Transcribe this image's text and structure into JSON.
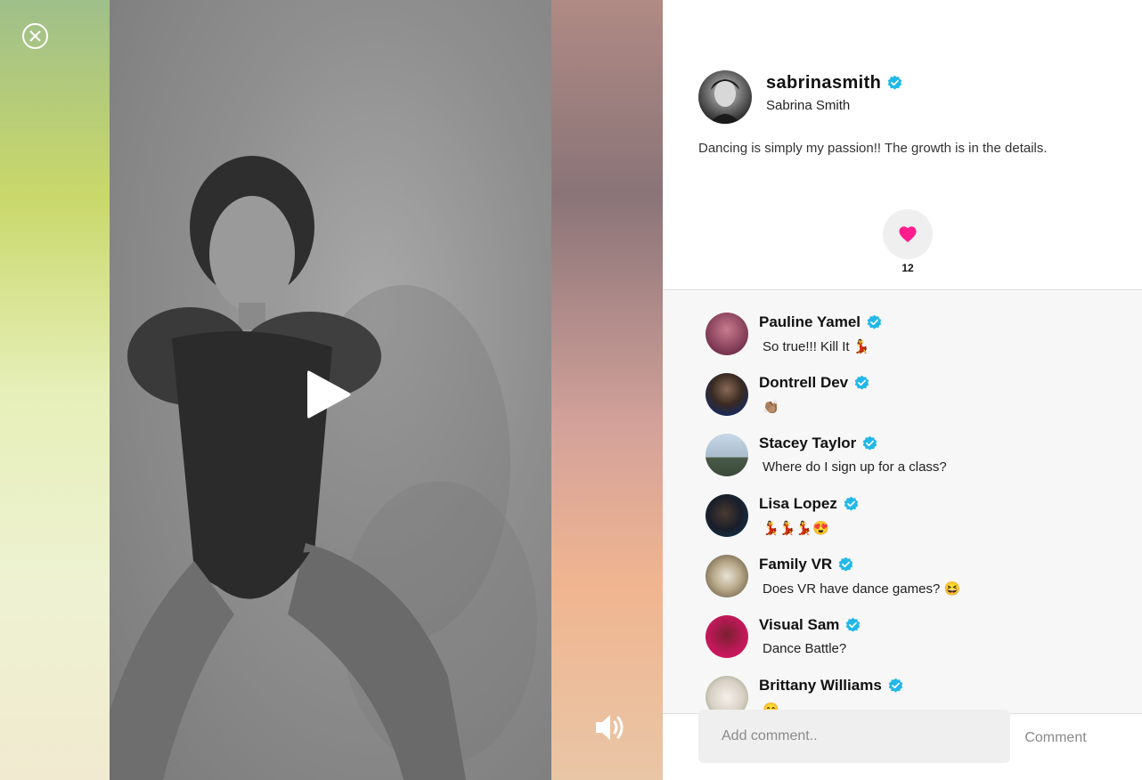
{
  "post": {
    "username": "sabrinasmith",
    "full_name": "Sabrina Smith",
    "caption": "Dancing is simply my passion!! The growth is in the details.",
    "like_count": "12",
    "verified": true
  },
  "media": {
    "close_icon": "close-circle-icon",
    "play_icon": "play-icon",
    "volume_icon": "volume-icon"
  },
  "comments": [
    {
      "name": "Pauline Yamel",
      "text": "So true!!! Kill It 💃",
      "avatar_color": "#8e4f6a"
    },
    {
      "name": "Dontrell Dev",
      "text": "👏🏽",
      "avatar_color": "#3a3a3a"
    },
    {
      "name": "Stacey Taylor",
      "text": "Where do I sign up for a class?",
      "avatar_color": "#9fb6c8"
    },
    {
      "name": "Lisa Lopez",
      "text": "💃💃💃😍",
      "avatar_color": "#1a2a3a"
    },
    {
      "name": "Family VR",
      "text": "Does VR have dance games? 😆",
      "avatar_color": "#b8a98a"
    },
    {
      "name": "Visual Sam",
      "text": "Dance Battle?",
      "avatar_color": "#c2185b"
    },
    {
      "name": "Brittany Williams",
      "text": "😊",
      "avatar_color": "#e8e2d8"
    }
  ],
  "comment_form": {
    "placeholder": "Add comment..",
    "submit_label": "Comment"
  },
  "colors": {
    "heart": "#ff1d8e",
    "verified": "#20b8e8"
  }
}
